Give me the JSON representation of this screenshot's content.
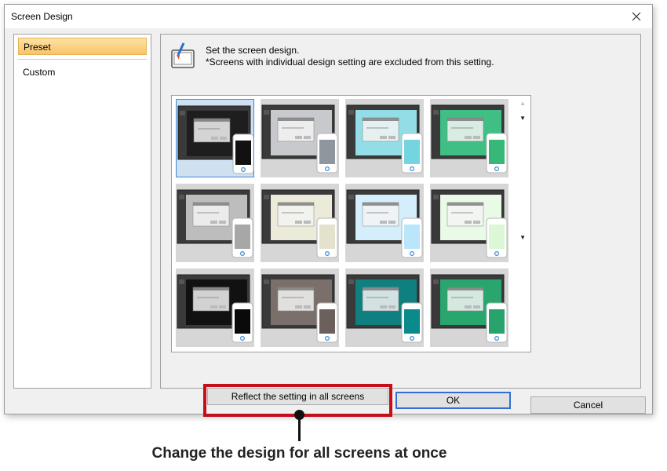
{
  "window": {
    "title": "Screen Design"
  },
  "sidebar": {
    "items": [
      {
        "label": "Preset",
        "selected": true
      },
      {
        "label": "Custom",
        "selected": false
      }
    ]
  },
  "main": {
    "description": [
      "Set the screen design.",
      "*Screens with individual design setting are excluded from this setting."
    ],
    "icon": "screen-design-icon",
    "presets": [
      {
        "name": "preset-1",
        "screen": "#1e1e1e",
        "phone": "#111111",
        "selected": true
      },
      {
        "name": "preset-2",
        "screen": "#c7c9cc",
        "phone": "#8f969d",
        "selected": false
      },
      {
        "name": "preset-3",
        "screen": "#93dde6",
        "phone": "#74d5e0",
        "selected": false
      },
      {
        "name": "preset-4",
        "screen": "#3fbf84",
        "phone": "#38b878",
        "selected": false
      },
      {
        "name": "preset-5",
        "screen": "#bdbdbd",
        "phone": "#a7a7a7",
        "selected": false
      },
      {
        "name": "preset-6",
        "screen": "#ecebd9",
        "phone": "#e4e2cc",
        "selected": false
      },
      {
        "name": "preset-7",
        "screen": "#d4effb",
        "phone": "#b9e6fb",
        "selected": false
      },
      {
        "name": "preset-8",
        "screen": "#e9fbe6",
        "phone": "#dcf7d6",
        "selected": false
      },
      {
        "name": "preset-9",
        "screen": "#111111",
        "phone": "#0a0a0a",
        "selected": false
      },
      {
        "name": "preset-10",
        "screen": "#7b6f6b",
        "phone": "#6b605c",
        "selected": false
      },
      {
        "name": "preset-11",
        "screen": "#0f7f7f",
        "phone": "#0a8a8a",
        "selected": false
      },
      {
        "name": "preset-12",
        "screen": "#29a56e",
        "phone": "#27a36b",
        "selected": false
      }
    ]
  },
  "buttons": {
    "reflect": "Reflect the setting in all screens",
    "ok": "OK",
    "cancel": "Cancel"
  },
  "annotation": {
    "caption": "Change the design for all screens at once"
  },
  "colors": {
    "highlight": "#c40f1b",
    "ok_border": "#2f6fd1",
    "selected_nav": "#f8c46a"
  }
}
